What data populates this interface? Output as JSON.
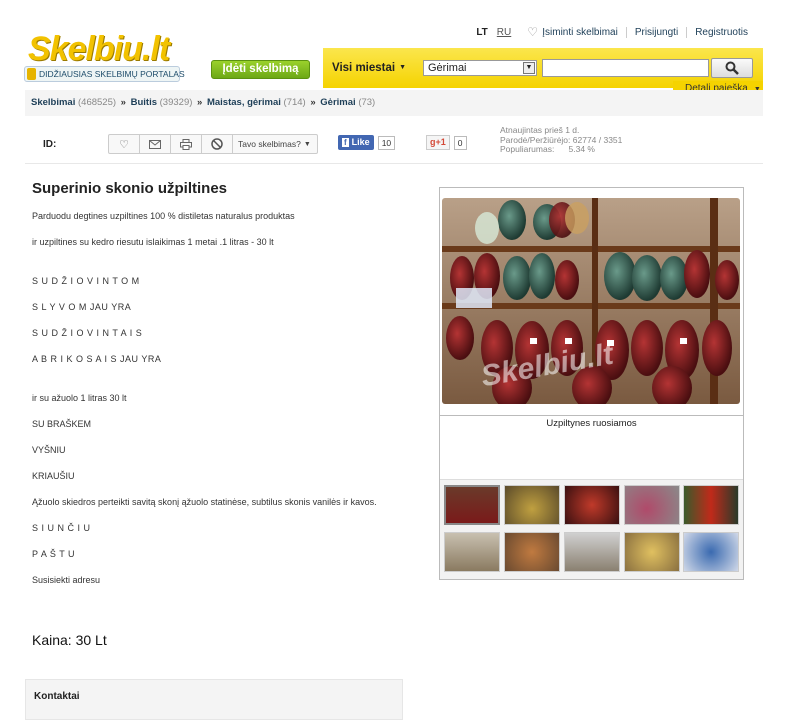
{
  "header": {
    "logo_text": "Skelbiu.lt",
    "logo_tagline": "DIDŽIAUSIAS SKELBIMŲ PORTALAS",
    "lang_active": "LT",
    "lang_other": "RU",
    "saved_link": "Įsiminti skelbimai",
    "login_link": "Prisijungti",
    "register_link": "Registruotis",
    "post_button": "Įdėti skelbimą",
    "city_dropdown": "Visi miestai",
    "category_select": "Gėrimai",
    "search_value": "",
    "advanced_search": "Detali paieška"
  },
  "breadcrumb": [
    {
      "label": "Skelbimai",
      "count": "(468525)"
    },
    {
      "label": "Buitis",
      "count": "(39329)"
    },
    {
      "label": "Maistas, gėrimai",
      "count": "(714)"
    },
    {
      "label": "Gėrimai",
      "count": "(73)"
    }
  ],
  "toolbar": {
    "id_label": "ID:",
    "your_ad_label": "Tavo skelbimas?",
    "fb_like": "Like",
    "fb_count": "10",
    "gplus": "+1",
    "gplus_count": "0",
    "stats_updated": "Atnaujintas prieš 1 d.",
    "stats_views": "Parodė/Peržiūrėjo: 62774 / 3351",
    "stats_popularity": "Populiarumas:      5.34 %"
  },
  "ad": {
    "title": "Superinio skonio užpiltines",
    "lines": [
      "Parduodu degtines uzpiltines 100 % distiletas naturalus produktas",
      "ir uzpiltines su kedro riesutu islaikimas 1 metai .1 litras - 30 lt",
      "S U D Ž I O V I N T O M",
      "S L Y V O M JAU YRA",
      "S U D Ž I O V I N T A I S",
      "A B R I K O S A I S JAU YRA",
      "ir su ažuolo 1 litras 30 lt",
      "SU BRAŠKEM",
      "VYŠNIU",
      "KRIAUŠIU",
      "Ąžuolo skiedros perteikti savitą skonį ąžuolo statinėse, subtilus skonis vanilės ir kavos.",
      "S I U N Č I U",
      "P A Š T U",
      "Susisiekti adresu"
    ],
    "price": "Kaina: 30 Lt",
    "contacts_heading": "Kontaktai"
  },
  "gallery": {
    "watermark": "Skelbiu.lt",
    "caption": "Uzpiltynes ruosiamos"
  },
  "colors": {
    "brand_yellow": "#f5d300",
    "post_green": "#7cb81e",
    "link_blue": "#1d3e57"
  }
}
